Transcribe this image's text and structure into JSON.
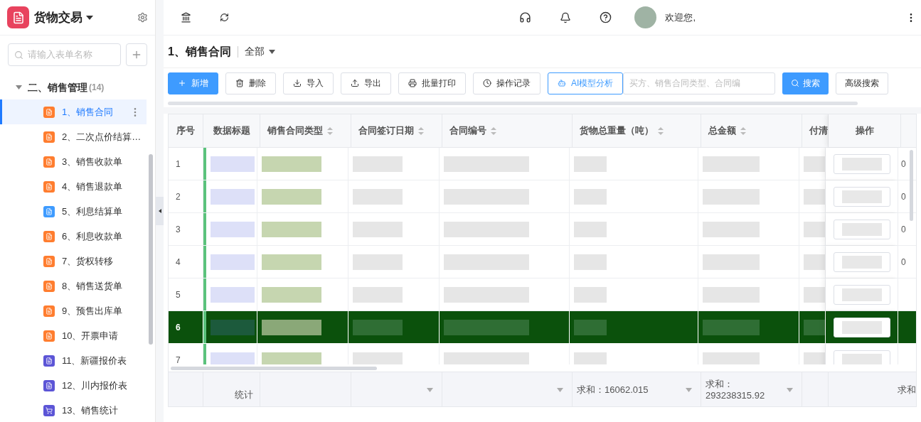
{
  "app": {
    "title": "货物交易"
  },
  "sidebar": {
    "search_placeholder": "请输入表单名称",
    "group": {
      "label": "二、销售管理",
      "count": "(14)",
      "expanded": true,
      "items": [
        {
          "label": "1、销售合同",
          "color": "#ff7d2f",
          "kind": "form",
          "selected": true
        },
        {
          "label": "2、二次点价结算…",
          "color": "#ff7d2f",
          "kind": "form",
          "selected": false
        },
        {
          "label": "3、销售收款单",
          "color": "#ff7d2f",
          "kind": "form",
          "selected": false
        },
        {
          "label": "4、销售退款单",
          "color": "#ff7d2f",
          "kind": "form",
          "selected": false
        },
        {
          "label": "5、利息结算单",
          "color": "#3e9bff",
          "kind": "form",
          "selected": false
        },
        {
          "label": "6、利息收款单",
          "color": "#ff7d2f",
          "kind": "form",
          "selected": false
        },
        {
          "label": "7、货权转移",
          "color": "#ff7d2f",
          "kind": "form",
          "selected": false
        },
        {
          "label": "8、销售送货单",
          "color": "#ff7d2f",
          "kind": "form",
          "selected": false
        },
        {
          "label": "9、预售出库单",
          "color": "#ff7d2f",
          "kind": "form",
          "selected": false
        },
        {
          "label": "10、开票申请",
          "color": "#ff7d2f",
          "kind": "form",
          "selected": false
        },
        {
          "label": "11、新疆报价表",
          "color": "#5c55d6",
          "kind": "form",
          "selected": false
        },
        {
          "label": "12、川内报价表",
          "color": "#5c55d6",
          "kind": "form",
          "selected": false
        },
        {
          "label": "13、销售统计",
          "color": "#5c55d6",
          "kind": "cart",
          "selected": false
        }
      ]
    }
  },
  "topbar": {
    "greeting": "欢迎您,"
  },
  "page": {
    "title": "1、销售合同",
    "filter": "全部"
  },
  "toolbar": {
    "buttons": [
      {
        "label": "新增",
        "kind": "primary"
      },
      {
        "label": "删除",
        "kind": "default"
      },
      {
        "label": "导入",
        "kind": "default"
      },
      {
        "label": "导出",
        "kind": "default"
      },
      {
        "label": "批量打印",
        "kind": "default"
      },
      {
        "label": "操作记录",
        "kind": "default"
      },
      {
        "label": "AI模型分析",
        "kind": "outline"
      }
    ],
    "search_placeholder": "买方、销售合同类型、合同编",
    "search_button": "搜索",
    "advanced_button": "高级搜索"
  },
  "table": {
    "columns": [
      {
        "label": "序号",
        "sortable": false
      },
      {
        "label": "数据标题",
        "sortable": false
      },
      {
        "label": "销售合同类型",
        "sortable": true
      },
      {
        "label": "合同签订日期",
        "sortable": true
      },
      {
        "label": "合同编号",
        "sortable": true
      },
      {
        "label": "货物总重量（吨）",
        "sortable": true
      },
      {
        "label": "总金额",
        "sortable": true
      },
      {
        "label": "付清"
      }
    ],
    "action_column": "操作",
    "rows": [
      {
        "index": "1",
        "selected": false,
        "column_9": "0"
      },
      {
        "index": "2",
        "selected": false,
        "column_9": "0"
      },
      {
        "index": "3",
        "selected": false,
        "column_9": "0"
      },
      {
        "index": "4",
        "selected": false,
        "column_9": "0"
      },
      {
        "index": "5",
        "selected": false
      },
      {
        "index": "6",
        "selected": true
      },
      {
        "index": "7",
        "selected": false
      }
    ],
    "footer": {
      "label": "统计",
      "weight_sum": "求和：16062.015",
      "amount_sum": "求和：293238315.92",
      "cut_sum": "求和"
    }
  }
}
